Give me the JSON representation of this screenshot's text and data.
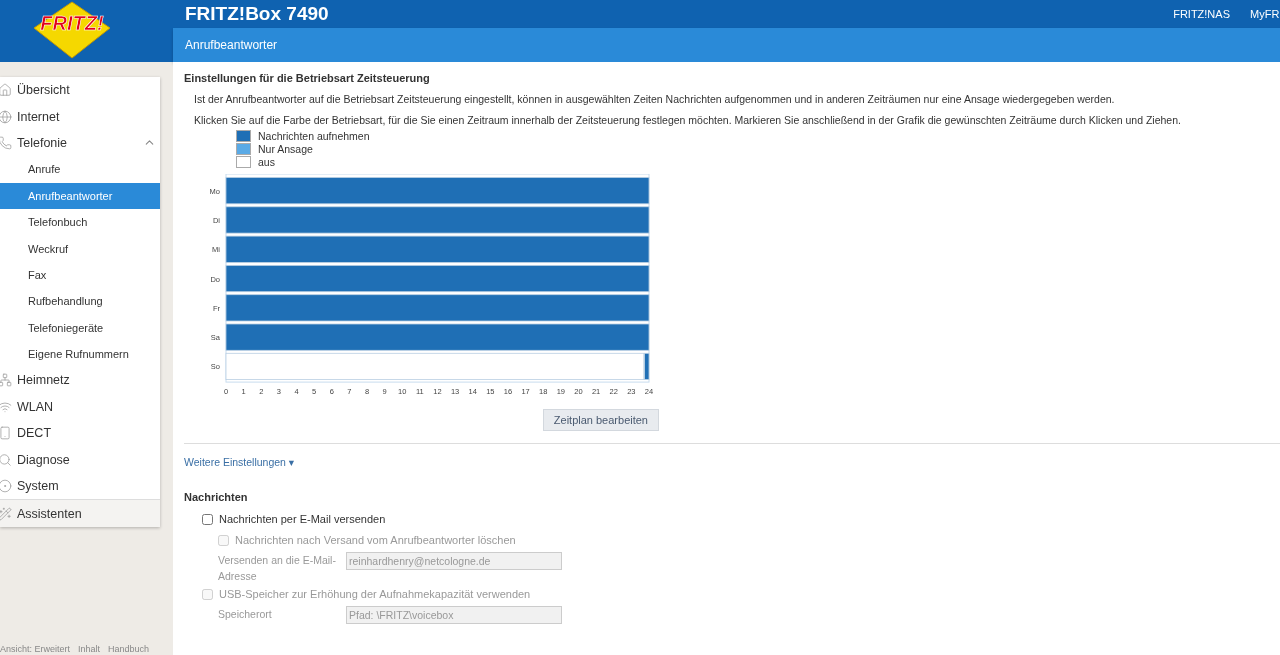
{
  "header": {
    "logo": "FRITZ!",
    "title": "FRITZ!Box 7490",
    "links": [
      "FRITZ!NAS",
      "MyFR"
    ]
  },
  "page_title": "Anrufbeantworter",
  "sidebar": {
    "items": [
      {
        "label": "Übersicht",
        "selected": false
      },
      {
        "label": "Internet",
        "selected": false
      },
      {
        "label": "Telefonie",
        "selected": false,
        "expanded": true,
        "children": [
          {
            "label": "Anrufe",
            "selected": false
          },
          {
            "label": "Anrufbeantworter",
            "selected": true
          },
          {
            "label": "Telefonbuch",
            "selected": false
          },
          {
            "label": "Weckruf",
            "selected": false
          },
          {
            "label": "Fax",
            "selected": false
          },
          {
            "label": "Rufbehandlung",
            "selected": false
          },
          {
            "label": "Telefoniegeräte",
            "selected": false
          },
          {
            "label": "Eigene Rufnummern",
            "selected": false
          }
        ]
      },
      {
        "label": "Heimnetz",
        "selected": false
      },
      {
        "label": "WLAN",
        "selected": false
      },
      {
        "label": "DECT",
        "selected": false
      },
      {
        "label": "Diagnose",
        "selected": false
      },
      {
        "label": "System",
        "selected": false
      }
    ],
    "assistant": {
      "label": "Assistenten"
    },
    "footer_links": [
      "Ansicht: Erweitert",
      "Inhalt",
      "Handbuch"
    ]
  },
  "schedule": {
    "heading": "Einstellungen für die Betriebsart Zeitsteuerung",
    "paragraphs": [
      "Ist der Anrufbeantworter auf die Betriebsart Zeitsteuerung eingestellt, können in ausgewählten Zeiten Nachrichten aufgenommen und in anderen Zeiträumen nur eine Ansage wiedergegeben werden.",
      "Klicken Sie auf die Farbe der Betriebsart, für die Sie einen Zeitraum innerhalb der Zeitsteuerung festlegen möchten. Markieren Sie anschließend in der Grafik die gewünschten Zeiträume durch Klicken und Ziehen."
    ],
    "chart_data": {
      "type": "bar",
      "orientation": "horizontal",
      "stacked": true,
      "categories": [
        "Mo",
        "Di",
        "Mi",
        "Do",
        "Fr",
        "Sa",
        "So"
      ],
      "series": [
        {
          "name": "Nachrichten aufnehmen",
          "color": "#1f6fb5",
          "values": [
            24,
            24,
            24,
            24,
            24,
            24,
            0.25
          ]
        },
        {
          "name": "Nur Ansage",
          "color": "#5aaae6",
          "values": [
            0,
            0,
            0,
            0,
            0,
            0,
            0
          ]
        },
        {
          "name": "aus",
          "color": "#ffffff",
          "values": [
            0,
            0,
            0,
            0,
            0,
            0,
            23.75
          ]
        }
      ],
      "xlim": [
        0,
        24
      ],
      "xticks": [
        0,
        1,
        2,
        3,
        4,
        5,
        6,
        7,
        8,
        9,
        10,
        11,
        12,
        13,
        14,
        15,
        16,
        17,
        18,
        19,
        20,
        21,
        22,
        23,
        24
      ]
    },
    "button": "Zeitplan bearbeiten"
  },
  "more_settings": "Weitere Einstellungen ▾",
  "messages": {
    "heading": "Nachrichten",
    "email_checkbox": {
      "label": "Nachrichten per E-Mail versenden",
      "checked": false,
      "disabled": false
    },
    "delete_checkbox": {
      "label": "Nachrichten nach Versand vom Anrufbeantworter löschen",
      "checked": false,
      "disabled": true
    },
    "email_field": {
      "label": "Versenden an die E-Mail-Adresse",
      "value": "reinhardhenry@netcologne.de",
      "disabled": true
    },
    "usb_checkbox": {
      "label": "USB-Speicher zur Erhöhung der Aufnahmekapazität verwenden",
      "checked": false,
      "disabled": true
    },
    "path_field": {
      "label": "Speicherort",
      "value": "Pfad: \\FRITZ\\voicebox",
      "disabled": true
    }
  }
}
